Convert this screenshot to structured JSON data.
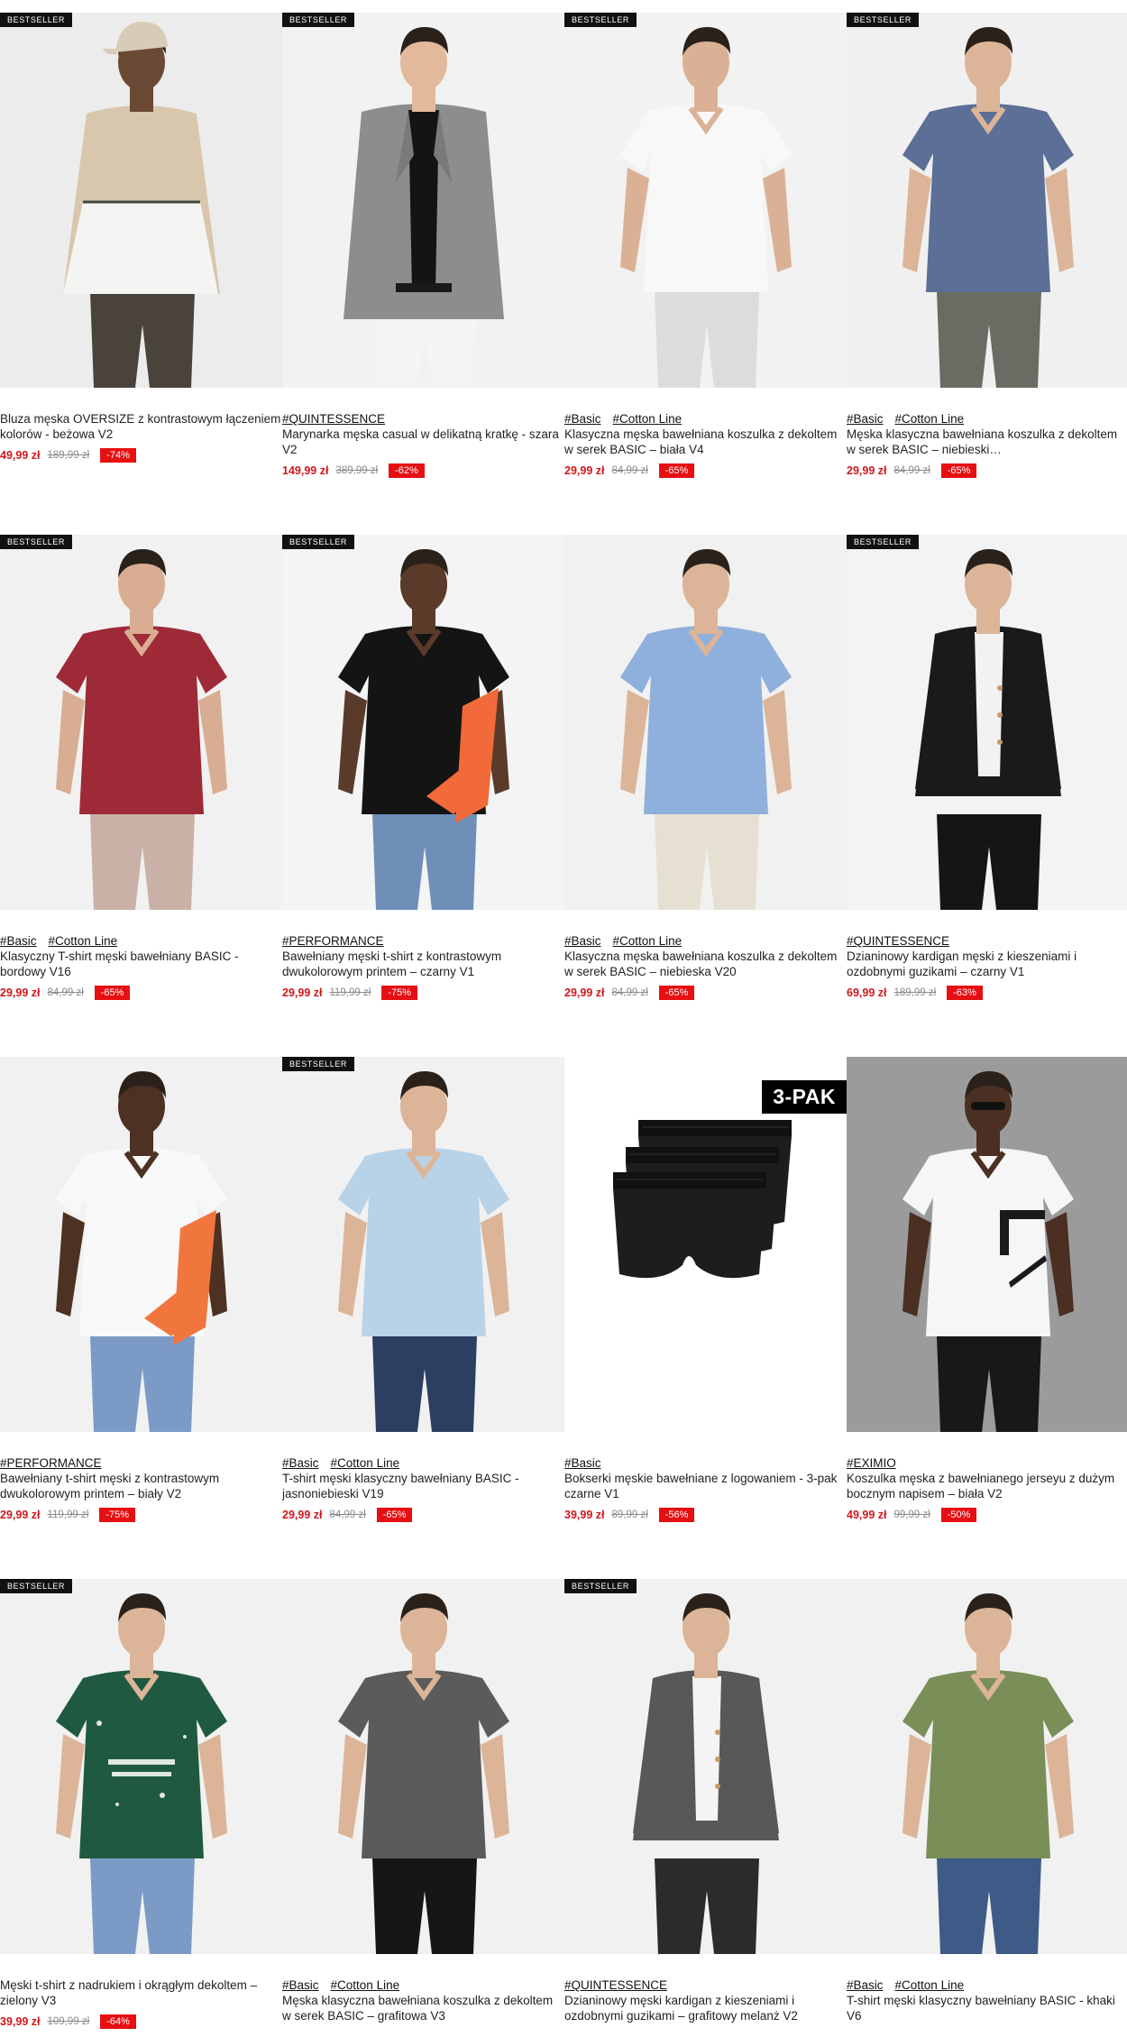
{
  "colors": {
    "accent_price": "#d0171c",
    "discount_badge": "#e60f12",
    "bestseller_badge": "#111111"
  },
  "products": [
    {
      "badge": "BESTSELLER",
      "tags": [],
      "title": "Bluza męska OVERSIZE z kontrastowym łączeniem kolorów - beżowa V2",
      "price": "49,99 zł",
      "old_price": "189,99 zł",
      "discount": "-74%"
    },
    {
      "badge": "BESTSELLER",
      "tags": [
        "#QUINTESSENCE"
      ],
      "title": "Marynarka męska casual w delikatną kratkę - szara V2",
      "price": "149,99 zł",
      "old_price": "389,99 zł",
      "discount": "-62%"
    },
    {
      "badge": "BESTSELLER",
      "tags": [
        "#Basic",
        "#Cotton Line"
      ],
      "title": "Klasyczna męska bawełniana koszulka z dekoltem w serek BASIC – biała V4",
      "price": "29,99 zł",
      "old_price": "84,99 zł",
      "discount": "-65%"
    },
    {
      "badge": "BESTSELLER",
      "tags": [
        "#Basic",
        "#Cotton Line"
      ],
      "title": "Męska klasyczna bawełniana koszulka z dekoltem w serek BASIC – niebieski…",
      "price": "29,99 zł",
      "old_price": "84,99 zł",
      "discount": "-65%"
    },
    {
      "badge": "BESTSELLER",
      "tags": [
        "#Basic",
        "#Cotton Line"
      ],
      "title": "Klasyczny T-shirt męski bawełniany BASIC - bordowy V16",
      "price": "29,99 zł",
      "old_price": "84,99 zł",
      "discount": "-65%"
    },
    {
      "badge": "BESTSELLER",
      "tags": [
        "#PERFORMANCE"
      ],
      "title": "Bawełniany męski t-shirt z kontrastowym dwukolorowym printem – czarny V1",
      "price": "29,99 zł",
      "old_price": "119,99 zł",
      "discount": "-75%"
    },
    {
      "badge": "",
      "tags": [
        "#Basic",
        "#Cotton Line"
      ],
      "title": "Klasyczna męska bawełniana koszulka z dekoltem w serek BASIC – niebieska V20",
      "price": "29,99 zł",
      "old_price": "84,99 zł",
      "discount": "-65%"
    },
    {
      "badge": "BESTSELLER",
      "tags": [
        "#QUINTESSENCE"
      ],
      "title": "Dzianinowy kardigan męski z kieszeniami i ozdobnymi guzikami – czarny V1",
      "price": "69,99 zł",
      "old_price": "189,99 zł",
      "discount": "-63%"
    },
    {
      "badge": "",
      "tags": [
        "#PERFORMANCE"
      ],
      "title": "Bawełniany t-shirt męski z kontrastowym dwukolorowym printem – biały V2",
      "price": "29,99 zł",
      "old_price": "119,99 zł",
      "discount": "-75%"
    },
    {
      "badge": "BESTSELLER",
      "tags": [
        "#Basic",
        "#Cotton Line"
      ],
      "title": "T-shirt męski klasyczny bawełniany BASIC - jasnoniebieski V19",
      "price": "29,99 zł",
      "old_price": "84,99 zł",
      "discount": "-65%"
    },
    {
      "badge": "",
      "pack_label": "3-PAK",
      "tags": [
        "#Basic"
      ],
      "title": "Bokserki męskie bawełniane z logowaniem - 3-pak czarne V1",
      "price": "39,99 zł",
      "old_price": "89,99 zł",
      "discount": "-56%"
    },
    {
      "badge": "",
      "tags": [
        "#EXIMIO"
      ],
      "title": "Koszulka męska z bawełnianego jerseyu z dużym bocznym napisem – biała V2",
      "price": "49,99 zł",
      "old_price": "99,99 zł",
      "discount": "-50%"
    },
    {
      "badge": "BESTSELLER",
      "tags": [],
      "title": "Męski t-shirt z nadrukiem i okrągłym dekoltem – zielony V3",
      "price": "39,99 zł",
      "old_price": "109,99 zł",
      "discount": "-64%"
    },
    {
      "badge": "",
      "tags": [
        "#Basic",
        "#Cotton Line"
      ],
      "title": "Męska klasyczna bawełniana koszulka z dekoltem w serek BASIC – grafitowa V3",
      "price": "",
      "old_price": "",
      "discount": ""
    },
    {
      "badge": "BESTSELLER",
      "tags": [
        "#QUINTESSENCE"
      ],
      "title": "Dzianinowy męski kardigan z kieszeniami i ozdobnymi guzikami – grafitowy melanż V2",
      "price": "",
      "old_price": "",
      "discount": ""
    },
    {
      "badge": "",
      "tags": [
        "#Basic",
        "#Cotton Line"
      ],
      "title": "T-shirt męski klasyczny bawełniany BASIC - khaki V6",
      "price": "",
      "old_price": "",
      "discount": ""
    }
  ]
}
